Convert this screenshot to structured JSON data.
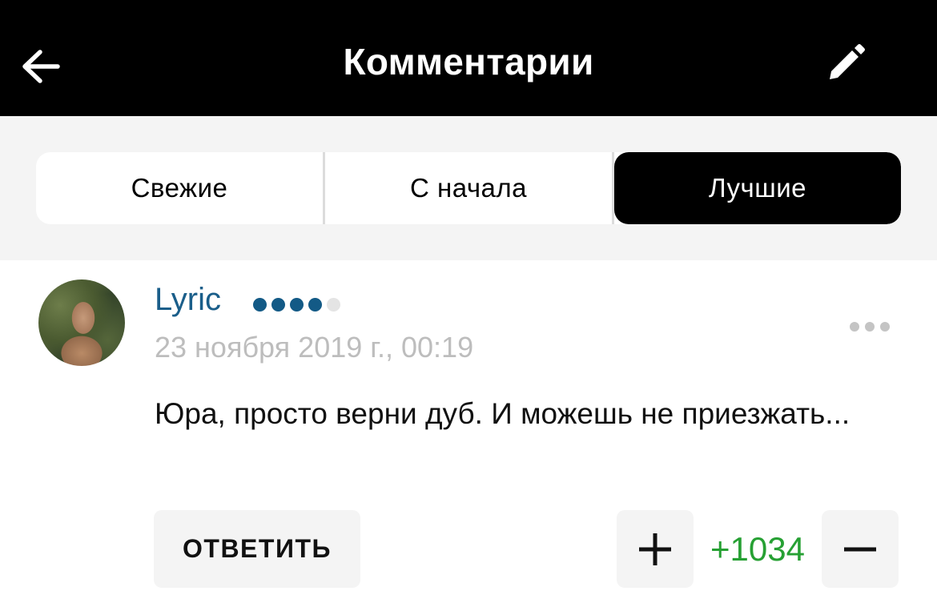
{
  "header": {
    "title": "Комментарии",
    "back_icon": "arrow-left-icon",
    "edit_icon": "pencil-icon"
  },
  "tabs": [
    {
      "label": "Свежие",
      "active": false
    },
    {
      "label": "С начала",
      "active": false
    },
    {
      "label": "Лучшие",
      "active": true
    }
  ],
  "comment": {
    "author": "Lyric",
    "rank_filled": 4,
    "rank_total": 5,
    "timestamp": "23 ноября 2019 г., 00:19",
    "text": "Юра, просто верни дуб. И можешь не приезжать...",
    "reply_label": "ОТВЕТИТЬ",
    "score": "+1034",
    "more_icon": "more-horizontal-icon"
  },
  "colors": {
    "header_bg": "#000000",
    "tabs_bg": "#f4f4f4",
    "username": "#1a5e8a",
    "score_positive": "#26a033",
    "timestamp": "#bdbdbd"
  }
}
